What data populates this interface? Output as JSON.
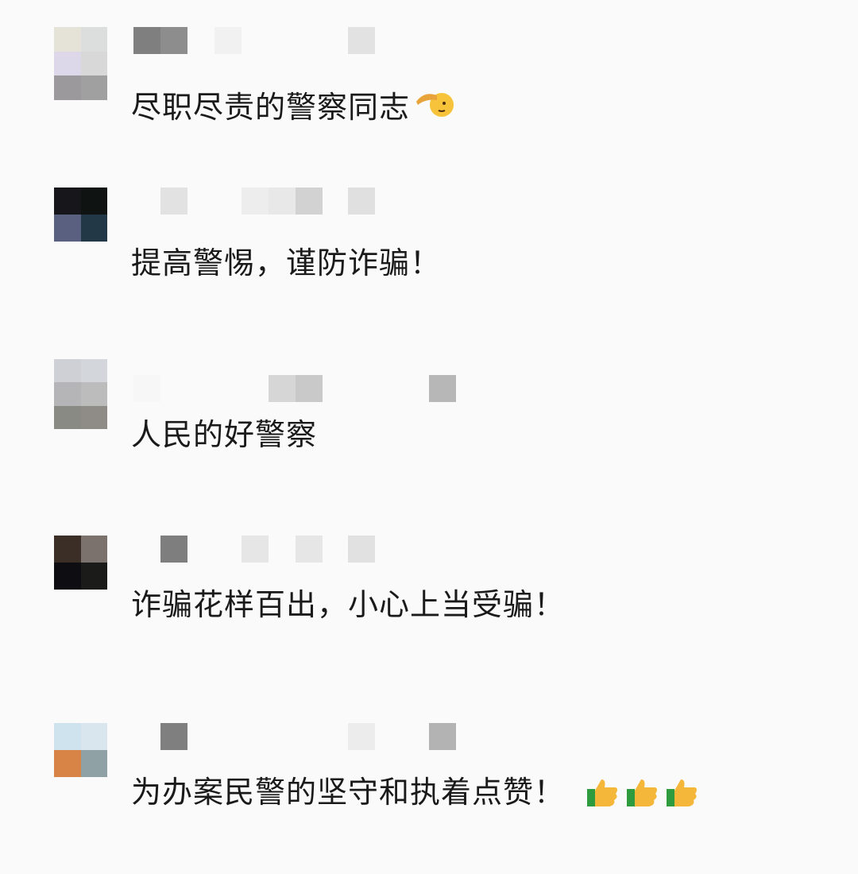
{
  "comments": [
    {
      "text": "尽职尽责的警察同志",
      "emoji": "salute-emoji"
    },
    {
      "text": "提高警惕，谨防诈骗！"
    },
    {
      "text": "人民的好警察"
    },
    {
      "text": "诈骗花样百出，小心上当受骗！"
    },
    {
      "text": "为办案民警的坚守和执着点赞！",
      "emoji": "thumbs-up-emoji-x3"
    }
  ],
  "colors": {
    "background": "#fafafa",
    "text": "#1a1a1a"
  }
}
